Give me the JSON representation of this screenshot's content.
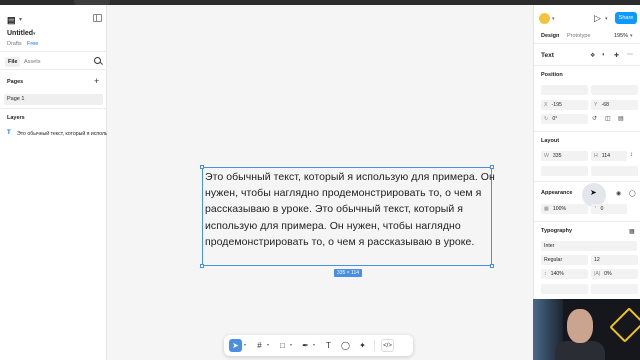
{
  "colors": {
    "accent": "#0d99ff",
    "selection": "#4a90e2",
    "canvas": "#f5f5f5"
  },
  "left_panel": {
    "file_title": "Untitled",
    "drafts": "Drafts",
    "plan": "Free",
    "tabs": [
      "File",
      "Assets"
    ],
    "pages_heading": "Pages",
    "pages": [
      "Page 1"
    ],
    "layers_heading": "Layers",
    "layers": [
      "Это обычный текст, который я использую для примера..."
    ]
  },
  "canvas": {
    "text": "Это обычный текст, который я использую для примера. Он нужен, чтобы наглядно продемонстрировать то, о чем я рассказываю в уроке. Это обычный текст, который я использую для примера. Он нужен, чтобы наглядно продемонстрировать то, о чем я рассказываю в уроке.",
    "size_badge": "335 × 114"
  },
  "toolbar": {
    "tools": [
      "move-icon",
      "frame-icon",
      "rectangle-icon",
      "pen-icon",
      "text-icon",
      "comment-icon",
      "actions-icon",
      "dev-mode-icon"
    ]
  },
  "right_panel": {
    "share_label": "Share",
    "tab_design": "Design",
    "tab_prototype": "Prototype",
    "zoom": "195%",
    "selection_title": "Text",
    "position": {
      "heading": "Position",
      "x_label": "X",
      "x_value": "-195",
      "y_label": "Y",
      "y_value": "-68",
      "rotation": "0°"
    },
    "layout": {
      "heading": "Layout",
      "w_label": "W",
      "w_value": "335",
      "h_label": "H",
      "h_value": "114"
    },
    "appearance": {
      "heading": "Appearance",
      "opacity": "100%",
      "radius": "0"
    },
    "typography": {
      "heading": "Typography",
      "font": "Inter",
      "weight": "Regular",
      "size": "12",
      "line_height": "140%",
      "letter_spacing": "0%"
    }
  }
}
